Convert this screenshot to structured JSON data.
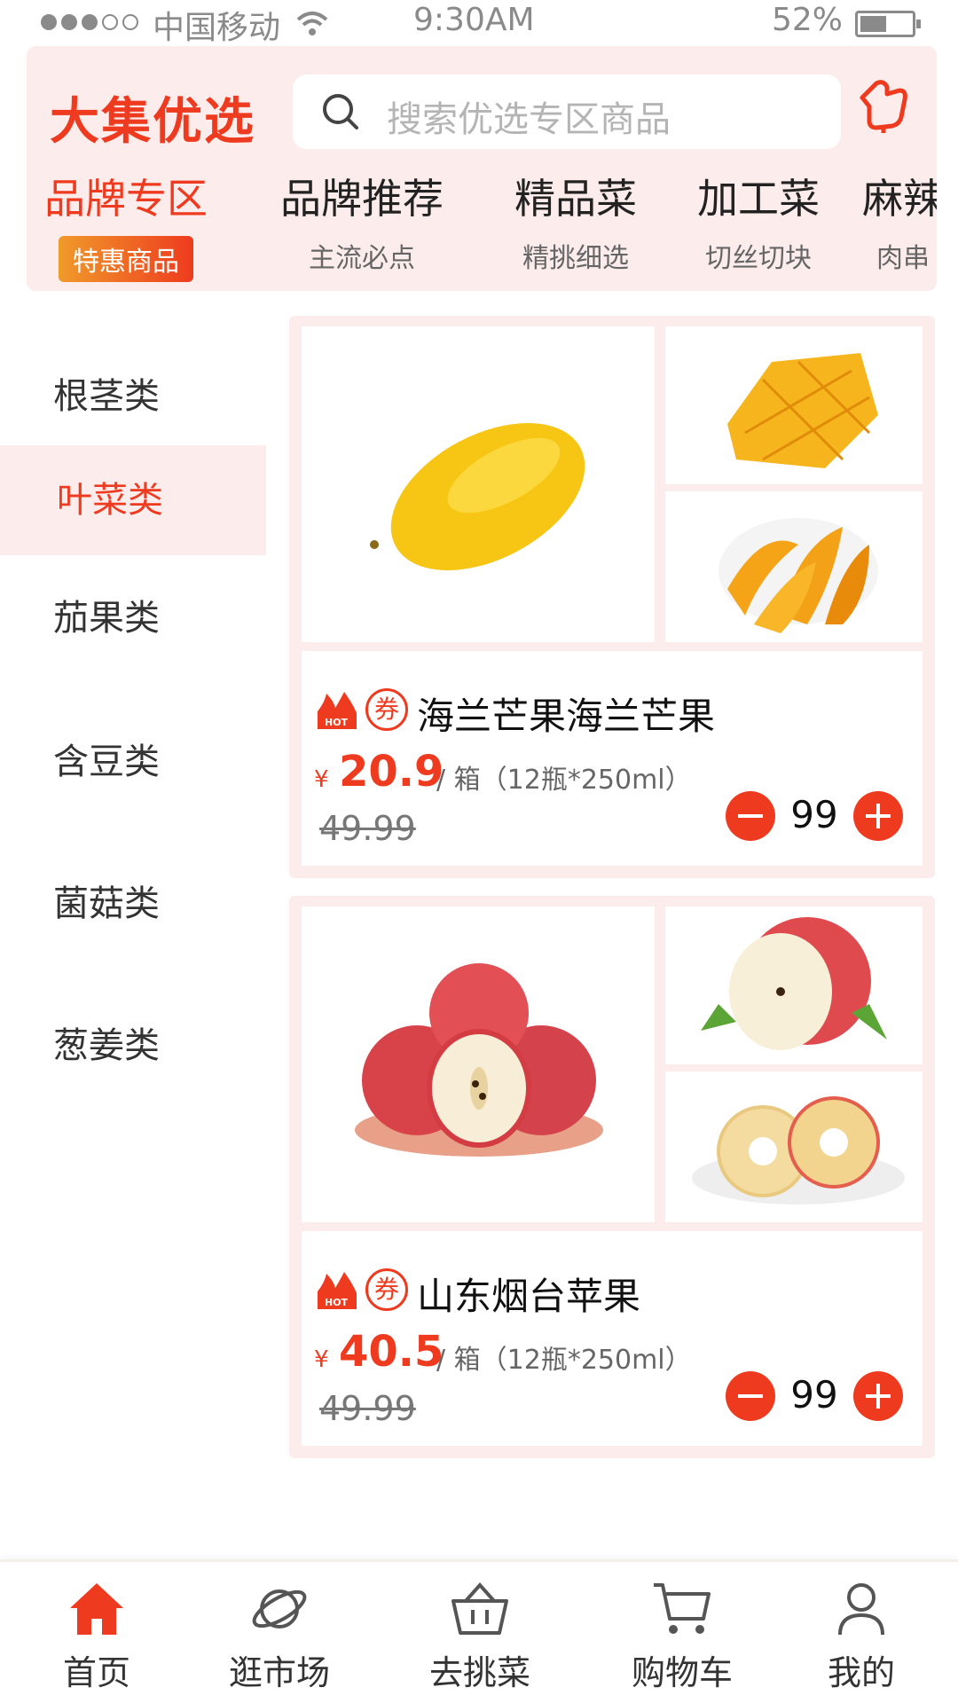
{
  "status_bar": {
    "carrier": "中国移动",
    "time": "9:30AM",
    "battery": "52%",
    "battery_level": 0.52
  },
  "header": {
    "brand": "大集优选",
    "search_placeholder": "搜索优选专区商品",
    "categories": [
      {
        "title": "品牌专区",
        "tag": "特惠商品",
        "active": true
      },
      {
        "title": "品牌推荐",
        "subtitle": "主流必点"
      },
      {
        "title": "精品菜",
        "subtitle": "精挑细选"
      },
      {
        "title": "加工菜",
        "subtitle": "切丝切块"
      },
      {
        "title": "麻辣",
        "subtitle": "肉串"
      }
    ]
  },
  "sidebar": {
    "items": [
      {
        "label": "根茎类"
      },
      {
        "label": "叶菜类",
        "active": true
      },
      {
        "label": "茄果类"
      },
      {
        "label": "含豆类"
      },
      {
        "label": "菌菇类"
      },
      {
        "label": "葱姜类"
      }
    ]
  },
  "products": [
    {
      "name": "海兰芒果海兰芒果",
      "currency": "¥",
      "price": "20.9",
      "unit": "/ 箱（12瓶*250ml）",
      "old_price": "49.99",
      "quantity": "99",
      "coupon": "券"
    },
    {
      "name": "山东烟台苹果",
      "currency": "¥",
      "price": "40.5",
      "unit": "/ 箱（12瓶*250ml）",
      "old_price": "49.99",
      "quantity": "99",
      "coupon": "券"
    }
  ],
  "tabbar": {
    "items": [
      {
        "label": "首页",
        "icon": "home-icon",
        "active": true
      },
      {
        "label": "逛市场",
        "icon": "planet-icon"
      },
      {
        "label": "去挑菜",
        "icon": "basket-icon"
      },
      {
        "label": "购物车",
        "icon": "cart-icon"
      },
      {
        "label": "我的",
        "icon": "user-icon"
      }
    ]
  },
  "colors": {
    "accent": "#ee3b1f",
    "header_bg": "#fdecec",
    "tag_gradient": [
      "#f09a2a",
      "#ee3b1f"
    ]
  }
}
